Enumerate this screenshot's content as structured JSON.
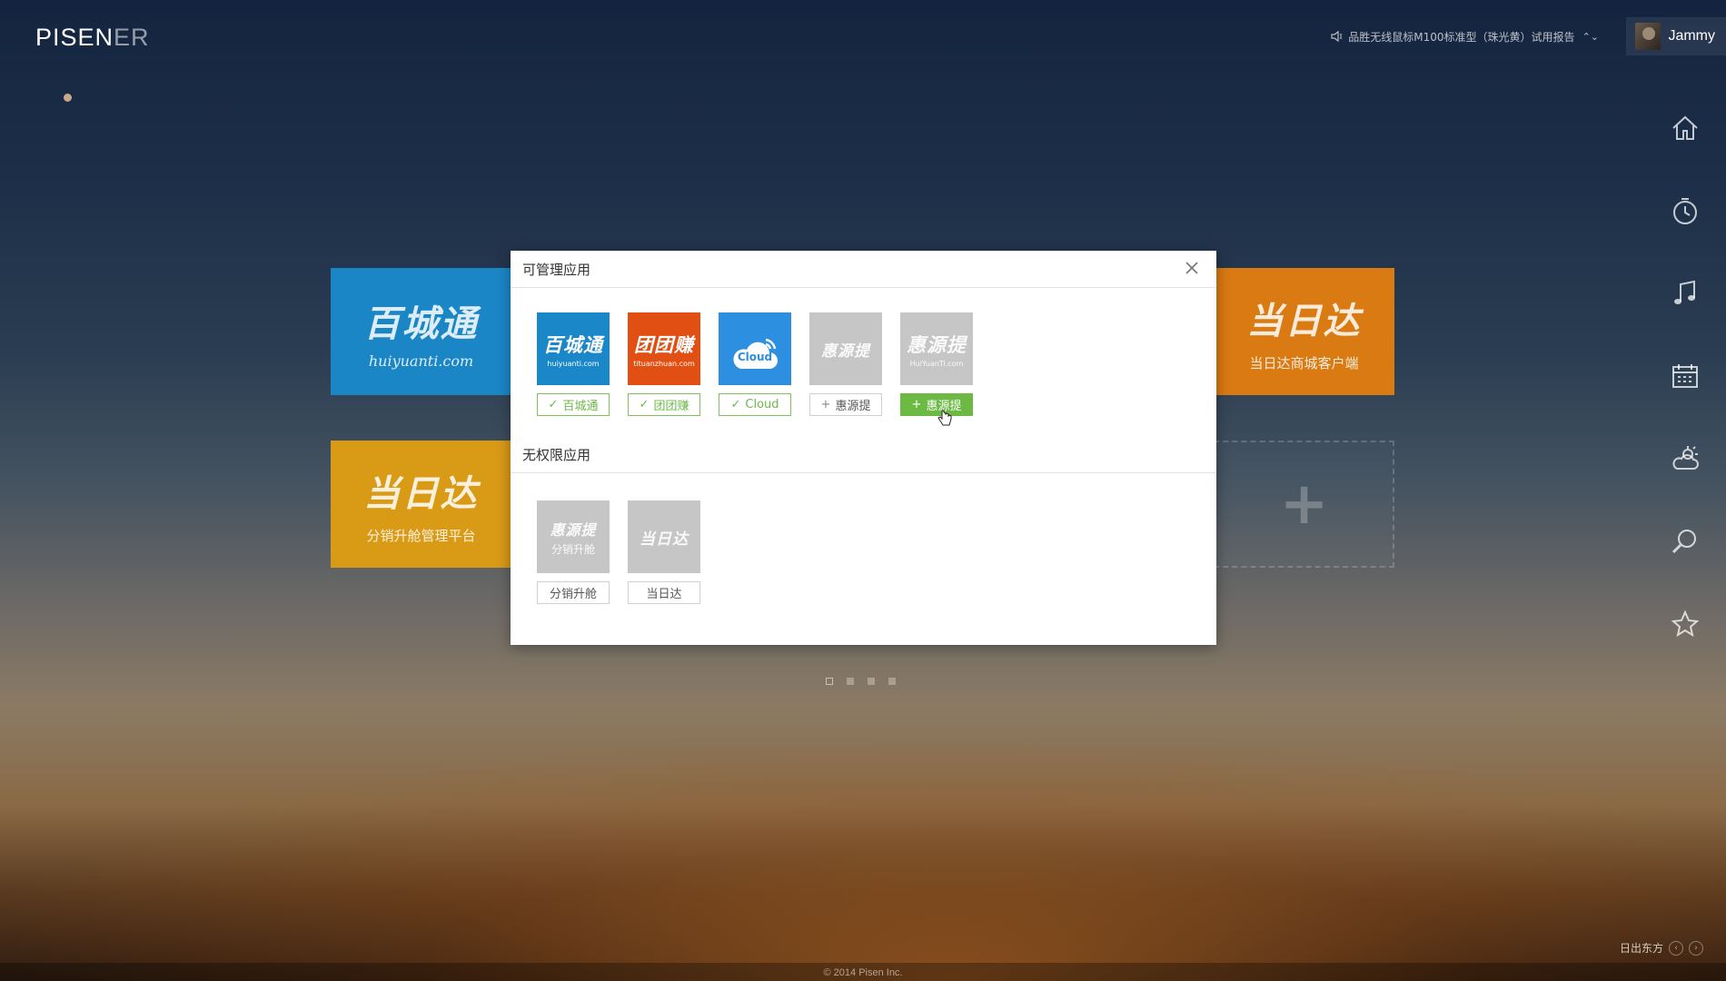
{
  "brand": {
    "logo_main": "PISEN",
    "logo_suffix": "ER"
  },
  "topbar": {
    "notice": "品胜无线鼠标M100标准型（珠光黄）试用报告",
    "notice_arrows": "⌃⌄",
    "user_name": "Jammy"
  },
  "rail": [
    {
      "name": "home-icon"
    },
    {
      "name": "clock-icon"
    },
    {
      "name": "music-icon"
    },
    {
      "name": "calendar-icon"
    },
    {
      "name": "weather-icon"
    },
    {
      "name": "search-icon"
    },
    {
      "name": "star-icon"
    }
  ],
  "tiles": [
    {
      "big": "百城通",
      "sub": "huiyuanti.com"
    },
    {
      "big": "当日达",
      "caption": "分销升舱管理平台"
    },
    {
      "big": "当日达",
      "caption": "当日达商城客户端"
    },
    {
      "plus": "+"
    }
  ],
  "dialog": {
    "manageable_title": "可管理应用",
    "unlimited_title": "无权限应用",
    "manageable_apps": [
      {
        "icon_main": "百城通",
        "icon_sub": "huiyuanti.com",
        "label": "百城通",
        "state": "checked",
        "mark": "✓"
      },
      {
        "icon_main": "团团赚",
        "icon_sub": "tituanzhuan.com",
        "label": "团团赚",
        "state": "checked",
        "mark": "✓"
      },
      {
        "icon_main": "Cloud",
        "icon_sub": "",
        "label": "Cloud",
        "state": "checked",
        "mark": "✓"
      },
      {
        "icon_main": "惠源提",
        "icon_sub": "",
        "label": "惠源提",
        "state": "add",
        "mark": "+"
      },
      {
        "icon_main": "惠源提",
        "icon_sub": "HuiYuanTi.com",
        "label": "惠源提",
        "state": "add-active",
        "mark": "+"
      }
    ],
    "unlimited_apps": [
      {
        "icon_main": "惠源提",
        "icon_sub": "分销升舱",
        "label": "分销升舱"
      },
      {
        "icon_main": "当日达",
        "icon_sub": "",
        "label": "当日达"
      }
    ]
  },
  "pager": {
    "count": 4,
    "active": 0
  },
  "footer": {
    "copyright": "© 2014 Pisen Inc.",
    "wallpaper_name": "日出东方"
  },
  "colors": {
    "tile_blue": "#1b86c6",
    "tile_yellow": "#d99a15",
    "tile_orange": "#d97a12",
    "checked_green": "#6cb74a",
    "active_green": "#6cba44"
  }
}
